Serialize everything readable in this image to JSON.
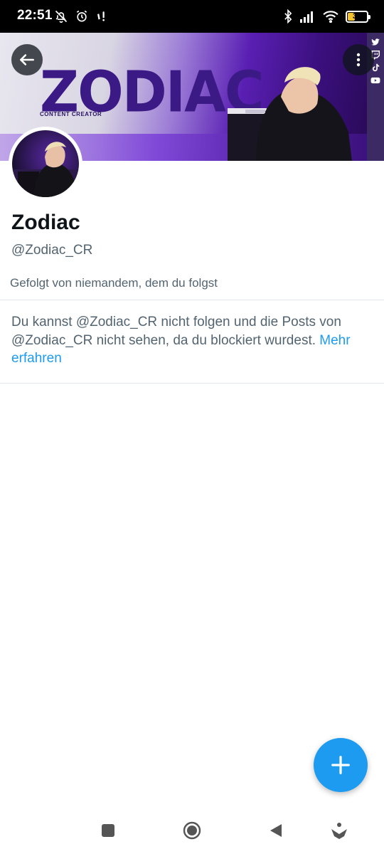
{
  "status_bar": {
    "time": "22:51",
    "battery": "35",
    "battery_level": 0.35,
    "icons_left": [
      "bell-off-icon",
      "alarm-icon",
      "sim-alert-icon"
    ],
    "icons_right": [
      "bluetooth-icon",
      "signal-icon",
      "wifi-icon",
      "battery-icon"
    ]
  },
  "banner": {
    "title": "ZODIAC",
    "subtitle": "CONTENT CREATOR",
    "socials": [
      "twitter-icon",
      "twitch-icon",
      "tiktok-icon",
      "youtube-icon"
    ],
    "colors": {
      "purple": "#5a1fb3",
      "light": "#e8e6ef"
    }
  },
  "profile": {
    "name": "Zodiac",
    "handle": "@Zodiac_CR",
    "followed_by": "Gefolgt von niemandem, dem du folgst"
  },
  "blocked": {
    "message": "Du kannst @Zodiac_CR nicht folgen und die Posts von @Zodiac_CR nicht sehen, da du blockiert wurdest. ",
    "link": "Mehr erfahren"
  },
  "accent": "#1d9bf0",
  "nav": [
    "recents-icon",
    "home-icon",
    "back-icon",
    "assistant-icon"
  ]
}
